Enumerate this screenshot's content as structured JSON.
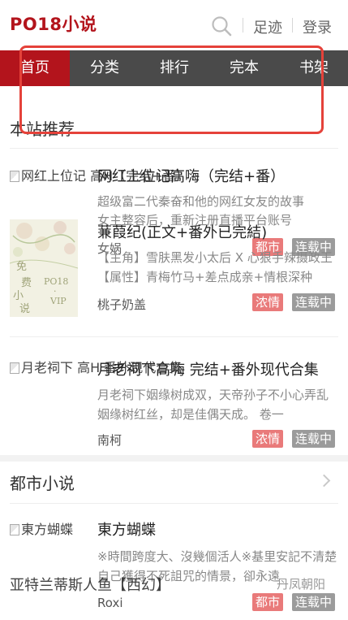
{
  "header": {
    "logo": "PO18小说",
    "footprint": "足迹",
    "login": "登录"
  },
  "nav": {
    "items": [
      {
        "label": "首页",
        "active": true
      },
      {
        "label": "分类",
        "active": false
      },
      {
        "label": "排行",
        "active": false
      },
      {
        "label": "完本",
        "active": false
      },
      {
        "label": "书架",
        "active": false
      }
    ]
  },
  "featured": {
    "title": "本站推荐",
    "books": [
      {
        "alt": "网红上位记 高H（完结+番）",
        "title": "网红上位记高嗨（完结+番）",
        "desc": "超级富二代秦奋和他的网红女友的故事",
        "genre": "都市",
        "status": "连载中"
      },
      {
        "title": "蒹葭纪(正文+番外已完結)",
        "desc": "【主角】雪肤黑发小太后 X 心狠手辣摄政王 【属性】青梅竹马+差点成亲+情根深种",
        "author": "桃子奶盖",
        "genre": "浓情",
        "status": "连载中",
        "cover_text": [
          "免",
          "费",
          "小",
          "说",
          "PO18",
          "·",
          "VIP"
        ]
      },
      {
        "alt": "月老祠下 高H 番外现代合集",
        "title": "月老祠下高嗨 完结+番外现代合集",
        "desc": "月老祠下姻缘树成双，天帝孙子不小心弄乱姻缘树红丝，却是佳偶天成。 卷一",
        "author": "南柯",
        "genre": "浓情",
        "status": "连载中"
      }
    ]
  },
  "overlaps": {
    "line1": "女主整容后，重新注册直播平台账号",
    "line2": "女娲",
    "line3": "月老祠下高嗨 完结+番外现代合集"
  },
  "city": {
    "title": "都市小说",
    "books": [
      {
        "alt": "東方蝴蝶",
        "title": "東方蝴蝶",
        "desc": "※時間跨度大、沒幾個活人※基里安記不清楚自己獲得不死詛咒的情景，卻永遠",
        "author": "Roxi",
        "genre": "都市",
        "status": "连载中"
      }
    ],
    "overlay_title": "亚特兰蒂斯人鱼【西幻】",
    "overlay_author": "丹凤朝阳"
  },
  "colors": {
    "brand": "#b3141c",
    "nav_bg": "#4a4a4a",
    "tag_genre": "#e97a7a",
    "tag_status": "#9b9b9b",
    "highlight": "#e5423a"
  }
}
